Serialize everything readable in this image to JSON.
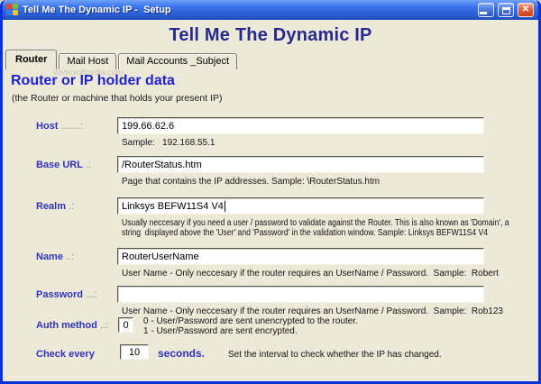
{
  "window": {
    "title": "Tell Me The Dynamic IP -  Setup",
    "heading": "Tell Me The Dynamic IP"
  },
  "titlebar_icons": {
    "app": "windows-logo",
    "minimize": "minimize",
    "maximize": "maximize",
    "close_glyph": "✕"
  },
  "tabs": [
    {
      "label": "Router",
      "active": true
    },
    {
      "label": "Mail Host",
      "active": false
    },
    {
      "label": "Mail Accounts _Subject",
      "active": false
    }
  ],
  "watermark": "www.softpedia.com",
  "section": {
    "title": "Router or IP holder data",
    "subtitle": "(the Router or machine that holds your present IP)"
  },
  "fields": {
    "host": {
      "label": "Host ",
      "dots": ".......:",
      "value": "199.66.62.6",
      "help": "Sample:   192.168.55.1"
    },
    "base_url": {
      "label": "Base URL ",
      "dots": ".:",
      "value": "/RouterStatus.htm",
      "help": "Page that contains the IP addresses. Sample: \\RouterStatus.htm"
    },
    "realm": {
      "label": "Realm ",
      "dots": ".:",
      "value": "Linksys BEFW11S4 V4",
      "help_line1": "Usually neccesary if you need a user / password to validate against the Router. This is also known as 'Domain', a",
      "help_line2": "string  displayed above the 'User' and 'Password' in the validation window. Sample: Linksys BEFW11S4 V4"
    },
    "name": {
      "label": "Name ",
      "dots": "..:",
      "value": "RouterUserName",
      "help": "User Name - Only neccesary if the router requires an UserName / Password.  Sample:  Robert"
    },
    "password": {
      "label": "Password ",
      "dots": "...:",
      "value": "",
      "help": "User Name - Only neccesary if the router requires an UserName / Password.  Sample:  Rob123"
    },
    "auth_method": {
      "label": "Auth method ",
      "dots": "..:",
      "value": "0",
      "help_line1": "0 - User/Password are sent unencrypted to the router.",
      "help_line2": "1 - User/Password are sent encrypted."
    },
    "check_every": {
      "label": "Check every",
      "value": "10",
      "unit": "seconds.",
      "help": "Set the interval to check whether the IP has changed."
    }
  },
  "colors": {
    "titlebar_blue": "#2E68E8",
    "window_border_blue": "#0831D9",
    "background_beige": "#ECE9D8",
    "heading_navy": "#28288E",
    "section_blue": "#2222CC",
    "label_blue": "#3333BB",
    "close_red": "#D9542E"
  }
}
